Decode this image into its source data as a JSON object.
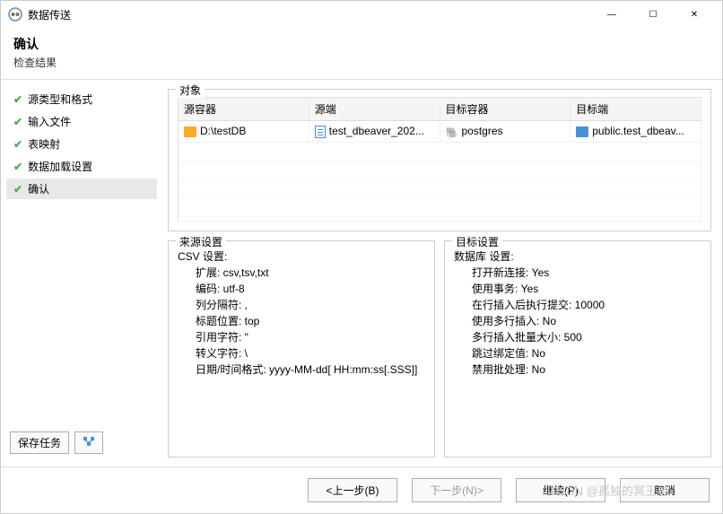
{
  "window": {
    "title": "数据传送",
    "minimize": "—",
    "maximize": "☐",
    "close": "✕"
  },
  "header": {
    "title": "确认",
    "subtitle": "检查结果"
  },
  "steps": [
    {
      "label": "源类型和格式"
    },
    {
      "label": "输入文件"
    },
    {
      "label": "表映射"
    },
    {
      "label": "数据加载设置"
    },
    {
      "label": "确认"
    }
  ],
  "sidebar_buttons": {
    "save_task": "保存任务",
    "config_icon": "⇅"
  },
  "objects": {
    "group_label": "对象",
    "columns": [
      "源容器",
      "源端",
      "目标容器",
      "目标端"
    ],
    "rows": [
      {
        "src_container": "D:\\testDB",
        "src": "test_dbeaver_202...",
        "tgt_container": "postgres",
        "tgt": "public.test_dbeav..."
      }
    ]
  },
  "source_settings": {
    "group_label": "来源设置",
    "lines": [
      "CSV 设置:",
      "扩展: csv,tsv,txt",
      "编码: utf-8",
      "列分隔符: ,",
      "标题位置: top",
      "引用字符: \"",
      "转义字符: \\",
      "日期/时间格式: yyyy-MM-dd[ HH:mm:ss[.SSS]]"
    ]
  },
  "target_settings": {
    "group_label": "目标设置",
    "lines": [
      "数据库 设置:",
      "打开新连接: Yes",
      "使用事务: Yes",
      "在行插入后执行提交: 10000",
      "使用多行插入: No",
      "多行插入批量大小: 500",
      "跳过绑定值: No",
      "禁用批处理: No"
    ]
  },
  "footer": {
    "back": "<上一步(B)",
    "next": "下一步(N)>",
    "continue": "继续(P)",
    "cancel": "取消"
  },
  "watermark": "CSDN @孤独的冥王星"
}
